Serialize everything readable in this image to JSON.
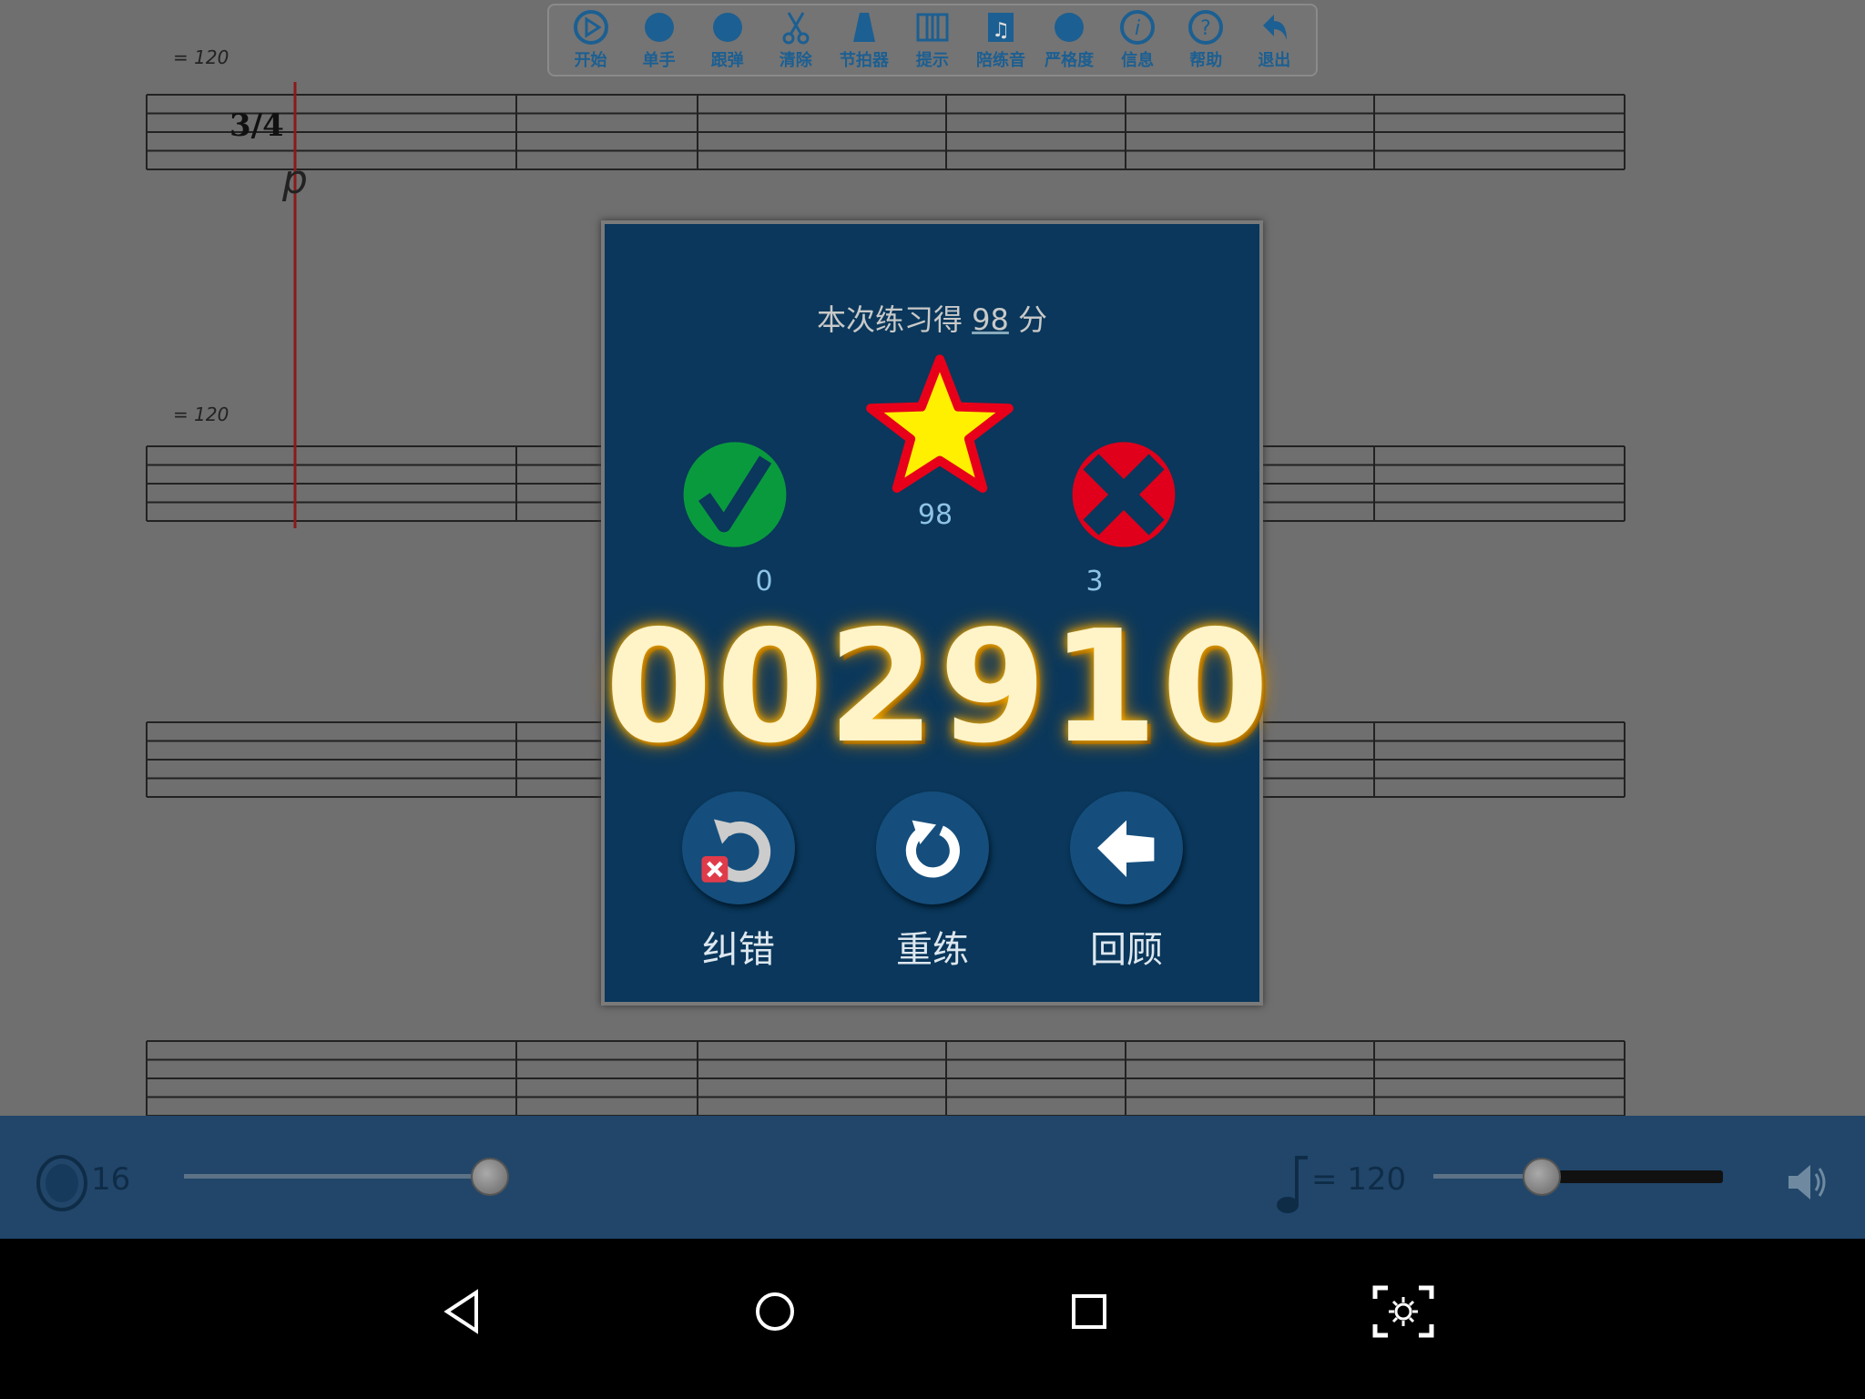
{
  "toolbar": {
    "items": [
      {
        "label": "开始",
        "icon": "play-icon"
      },
      {
        "label": "单手",
        "icon": "hand-icon"
      },
      {
        "label": "跟弹",
        "icon": "follow-hand-icon"
      },
      {
        "label": "清除",
        "icon": "scissors-icon"
      },
      {
        "label": "节拍器",
        "icon": "metronome-icon"
      },
      {
        "label": "提示",
        "icon": "keyboard-icon"
      },
      {
        "label": "陪练音",
        "icon": "music-note-icon"
      },
      {
        "label": "严格度",
        "icon": "strictness-icon"
      },
      {
        "label": "信息",
        "icon": "info-icon"
      },
      {
        "label": "帮助",
        "icon": "help-icon"
      },
      {
        "label": "退出",
        "icon": "exit-arrow-icon"
      }
    ]
  },
  "sheet": {
    "tempo_marks": [
      "= 120",
      "= 120"
    ],
    "time_signature": "3/4",
    "dynamic": "p"
  },
  "dialog": {
    "title_prefix": "本次练习得",
    "title_score": "98",
    "title_suffix": "分",
    "star_score": "98",
    "correct_count": "0",
    "wrong_count": "3",
    "total_score": "002910",
    "buttons": [
      {
        "label": "纠错",
        "icon": "undo-error-icon"
      },
      {
        "label": "重练",
        "icon": "replay-icon"
      },
      {
        "label": "回顾",
        "icon": "review-back-icon"
      }
    ]
  },
  "bottom_bar": {
    "count_value": "16",
    "tempo_value": "= 120",
    "count_slider_fraction": 1.0,
    "tempo_slider_fraction": 0.37
  },
  "colors": {
    "dialog_bg": "#0a375b",
    "bottom_bar": "#21466a",
    "correct": "#0a9a3e",
    "wrong": "#e0001b",
    "star": "#fff000"
  }
}
